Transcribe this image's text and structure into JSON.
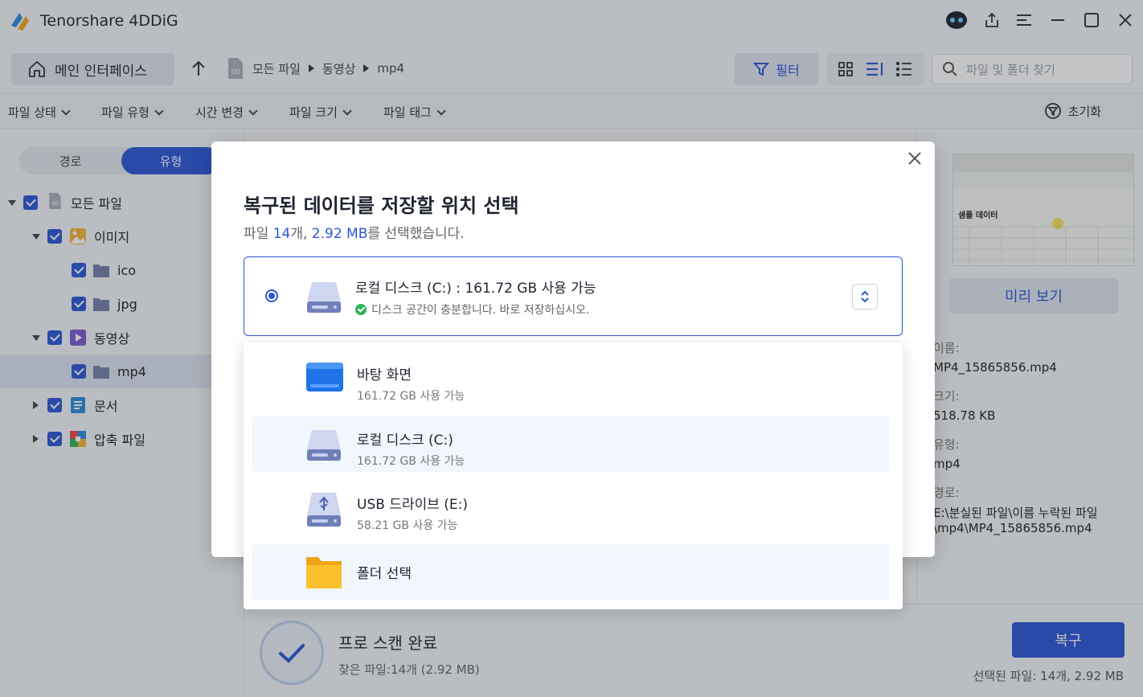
{
  "app": {
    "title": "Tenorshare 4DDiG"
  },
  "toolbar": {
    "home_label": "메인 인터페이스",
    "breadcrumb": [
      "모든 파일",
      "동영상",
      "mp4"
    ],
    "filter_label": "필터",
    "search_placeholder": "파일 및 폴더 찾기"
  },
  "filterbar": {
    "items": [
      "파일 상태",
      "파일 유형",
      "시간 변경",
      "파일 크기",
      "파일 태그"
    ],
    "reset_label": "초기화"
  },
  "sidebar": {
    "tab_path": "경로",
    "tab_type": "유형",
    "tree": [
      {
        "label": "모든 파일",
        "level": 0,
        "expanded": true,
        "icon": "sd-card-icon"
      },
      {
        "label": "이미지",
        "level": 1,
        "expanded": true,
        "icon": "image-icon"
      },
      {
        "label": "ico",
        "level": 2,
        "icon": "folder-icon"
      },
      {
        "label": "jpg",
        "level": 2,
        "icon": "folder-icon"
      },
      {
        "label": "동영상",
        "level": 1,
        "expanded": true,
        "icon": "video-icon"
      },
      {
        "label": "mp4",
        "level": 2,
        "icon": "folder-icon",
        "selected": true
      },
      {
        "label": "문서",
        "level": 1,
        "expanded": false,
        "icon": "document-icon"
      },
      {
        "label": "압축 파일",
        "level": 1,
        "expanded": false,
        "icon": "archive-icon"
      }
    ]
  },
  "preview": {
    "thumb_caption": "샘플 데이터",
    "button_label": "미리 보기",
    "name_key": "이름:",
    "name_value": "MP4_15865856.mp4",
    "size_key": "크기:",
    "size_value": "518.78 KB",
    "type_key": "유형:",
    "type_value": "mp4",
    "path_key": "경로:",
    "path_value_1": "E:\\분실된 파일\\이름 누락된 파일",
    "path_value_2": "\\mp4\\MP4_15865856.mp4"
  },
  "bottom": {
    "scan_title": "프로 스캔 완료",
    "scan_sub": "찾은 파일:14개 (2.92 MB)",
    "recover_label": "복구",
    "selected_info": "선택된 파일: 14개, 2.92 MB"
  },
  "modal": {
    "title": "복구된 데이터를 저장할 위치 선택",
    "sub_prefix": "파일 ",
    "sub_count": "14",
    "sub_mid": "개, ",
    "sub_size": "2.92 MB",
    "sub_suffix": "를 선택했습니다.",
    "selected_dest": "로컬 디스크 (C:) : 161.72 GB 사용 가능",
    "selected_msg": "디스크 공간이 충분합니다. 바로 저장하십시오."
  },
  "dropdown": {
    "items": [
      {
        "name": "바탕 화면",
        "free": "161.72 GB 사용 가능",
        "icon": "desktop-icon"
      },
      {
        "name": "로컬 디스크 (C:)",
        "free": "161.72 GB 사용 가능",
        "icon": "hard-disk-icon"
      },
      {
        "name": "USB 드라이브 (E:)",
        "free": "58.21 GB 사용 가능",
        "icon": "usb-drive-icon"
      },
      {
        "name": "폴더 선택",
        "free": "",
        "icon": "folder-icon"
      }
    ]
  },
  "colors": {
    "accent": "#2c56d6",
    "success": "#2fb45a"
  }
}
